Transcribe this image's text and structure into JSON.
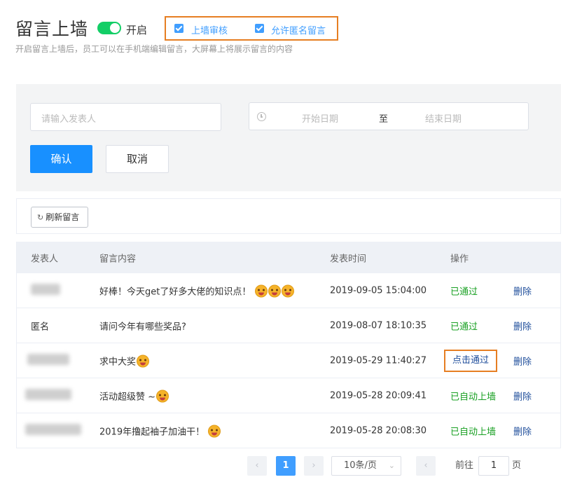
{
  "header": {
    "title": "留言上墙",
    "switch_label": "开启",
    "switch_on": true,
    "options": [
      {
        "label": "上墙审核",
        "checked": true
      },
      {
        "label": "允许匿名留言",
        "checked": true
      }
    ],
    "subtitle": "开启留言上墙后，员工可以在手机端编辑留言，大屏幕上将展示留言的内容"
  },
  "filter": {
    "publisher_placeholder": "请输入发表人",
    "date_start_placeholder": "开始日期",
    "date_separator": "至",
    "date_end_placeholder": "结束日期",
    "confirm_label": "确认",
    "cancel_label": "取消"
  },
  "toolbar": {
    "refresh_label": "刷新留言"
  },
  "table": {
    "columns": [
      "发表人",
      "留言内容",
      "发表时间",
      "操作"
    ],
    "rows": [
      {
        "publisher": "",
        "message": "好棒！今天get了好多大佬的知识点！",
        "emoji_count": 3,
        "time": "2019-09-05 15:04:00",
        "action": "已通过",
        "delete": "删除"
      },
      {
        "publisher": "匿名",
        "message": "请问今年有哪些奖品?",
        "emoji_count": 0,
        "time": "2019-08-07 18:10:35",
        "action": "已通过",
        "delete": "删除"
      },
      {
        "publisher": "",
        "message": "求中大奖",
        "emoji_count": 1,
        "time": "2019-05-29 11:40:27",
        "action": "点击通过",
        "delete": "删除"
      },
      {
        "publisher": "",
        "message": "活动超级赞 ~",
        "emoji_count": 1,
        "time": "2019-05-28 20:09:41",
        "action": "已自动上墙",
        "delete": "删除"
      },
      {
        "publisher": "",
        "message": "2019年撸起袖子加油干！",
        "emoji_count": 1,
        "time": "2019-05-28 20:08:30",
        "action": "已自动上墙",
        "delete": "删除"
      }
    ]
  },
  "pagination": {
    "current_page": "1",
    "page_size": "10条/页",
    "goto_prefix": "前往",
    "goto_value": "1",
    "goto_suffix": "页"
  },
  "colors": {
    "accent": "#1890ff",
    "success": "#19a023",
    "highlight_box": "#e67e22",
    "switch_on": "#13ce66"
  }
}
